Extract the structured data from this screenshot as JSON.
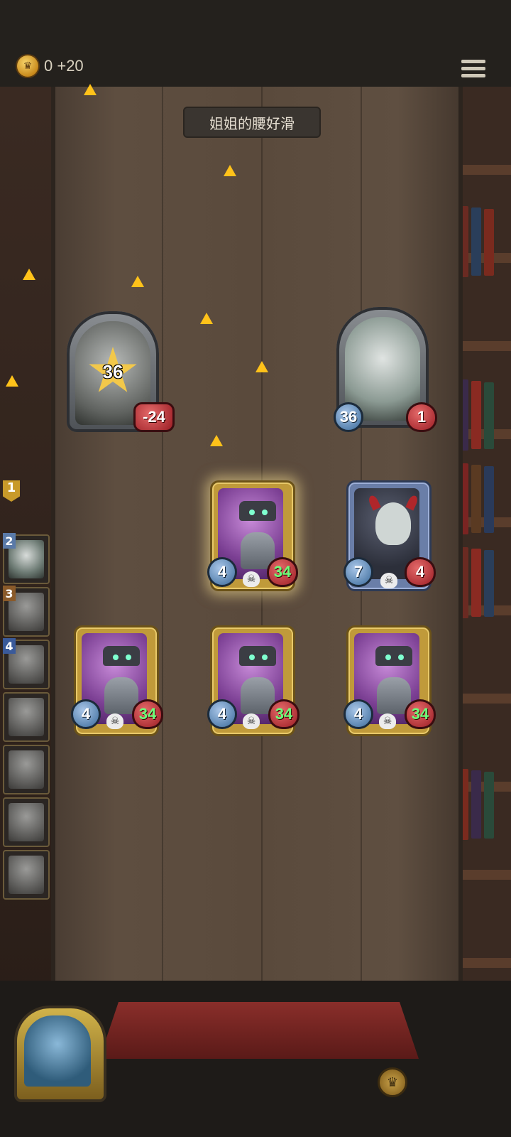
{
  "topbar": {
    "gold": "0 +20",
    "coin_icon": "crown-coin-icon",
    "menu_icon": "hamburger-menu-icon"
  },
  "board": {
    "opponent_name": "姐姐的腰好滑"
  },
  "heroes": {
    "player": {
      "attack_burst": "36",
      "health": "-24"
    },
    "opponent": {
      "attack": "36",
      "health": "1"
    }
  },
  "minions": {
    "top_left": {
      "attack": "4",
      "health": "34",
      "health_color": "#6dff7a",
      "selected": true
    },
    "top_right": {
      "attack": "7",
      "health": "4"
    },
    "bottom_1": {
      "attack": "4",
      "health": "34",
      "health_color": "#6dff7a"
    },
    "bottom_2": {
      "attack": "4",
      "health": "34",
      "health_color": "#6dff7a"
    },
    "bottom_3": {
      "attack": "4",
      "health": "34",
      "health_color": "#6dff7a"
    }
  },
  "turn_order": [
    {
      "num": "1"
    },
    {
      "num": "2"
    },
    {
      "num": "3"
    },
    {
      "num": "4"
    },
    {
      "num": ""
    },
    {
      "num": ""
    },
    {
      "num": ""
    },
    {
      "num": ""
    }
  ],
  "bottom": {
    "player_portrait_icon": "player-hero-portrait",
    "action_icon": "crown-button-icon"
  }
}
